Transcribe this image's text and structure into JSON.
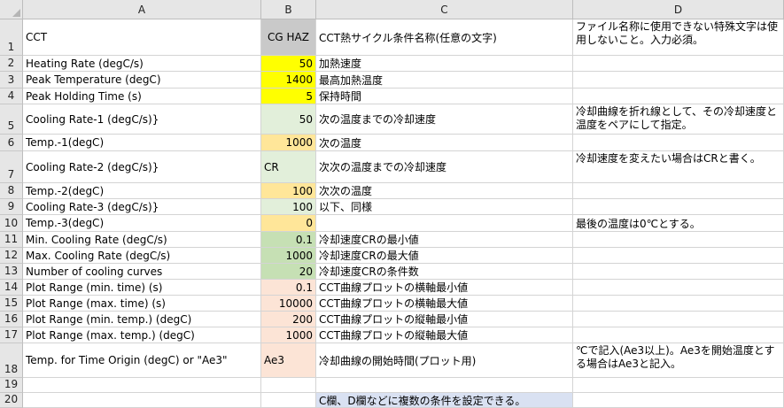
{
  "colors": {
    "yellow": "#ffff00",
    "light_green": "#e2efda",
    "orange": "#ffe699",
    "green": "#c6e0b4",
    "peach": "#fce4d6",
    "gray": "#c9c9c9",
    "blue": "#d9e1f2",
    "header": "#e6e6e6"
  },
  "columns": [
    "A",
    "B",
    "C",
    "D"
  ],
  "rows": [
    {
      "num": "1",
      "a": "CCT",
      "b": "CG HAZ",
      "c": "CCT熱サイクル条件名称(任意の文字)",
      "d": "ファイル名称に使用できない特殊文字は使用しないこと。入力必須。",
      "b_fill": "gray",
      "b_align": "center"
    },
    {
      "num": "2",
      "a": "Heating Rate (degC/s)",
      "b": "50",
      "c": "加熱速度",
      "d": "",
      "b_fill": "yellow",
      "b_align": "right"
    },
    {
      "num": "3",
      "a": "Peak Temperature (degC)",
      "b": "1400",
      "c": "最高加熱温度",
      "d": "",
      "b_fill": "yellow",
      "b_align": "right"
    },
    {
      "num": "4",
      "a": "Peak Holding Time (s)",
      "b": "5",
      "c": "保持時間",
      "d": "",
      "b_fill": "yellow",
      "b_align": "right"
    },
    {
      "num": "5",
      "a": "Cooling Rate-1 (degC/s)}",
      "b": "50",
      "c": "次の温度までの冷却速度",
      "d": "冷却曲線を折れ線として、その冷却速度と温度をペアにして指定。",
      "b_fill": "light_green",
      "b_align": "right"
    },
    {
      "num": "6",
      "a": "Temp.-1(degC)",
      "b": "1000",
      "c": "次の温度",
      "d": "",
      "b_fill": "orange",
      "b_align": "right"
    },
    {
      "num": "7",
      "a": "Cooling Rate-2 (degC/s)}",
      "b": "CR",
      "c": "次次の温度までの冷却速度",
      "d": "冷却速度を変えたい場合はCRと書く。",
      "b_fill": "light_green",
      "b_align": "left"
    },
    {
      "num": "8",
      "a": "Temp.-2(degC)",
      "b": "100",
      "c": "次次の温度",
      "d": "",
      "b_fill": "orange",
      "b_align": "right"
    },
    {
      "num": "9",
      "a": "Cooling Rate-3 (degC/s)}",
      "b": "100",
      "c": "以下、同様",
      "d": "",
      "b_fill": "light_green",
      "b_align": "right"
    },
    {
      "num": "10",
      "a": "Temp.-3(degC)",
      "b": "0",
      "c": "",
      "d": "最後の温度は0℃とする。",
      "b_fill": "orange",
      "b_align": "right"
    },
    {
      "num": "11",
      "a": "Min. Cooling Rate (degC/s)",
      "b": "0.1",
      "c": "冷却速度CRの最小値",
      "d": "",
      "b_fill": "green",
      "b_align": "right"
    },
    {
      "num": "12",
      "a": "Max. Cooling Rate (degC/s)",
      "b": "1000",
      "c": "冷却速度CRの最大値",
      "d": "",
      "b_fill": "green",
      "b_align": "right"
    },
    {
      "num": "13",
      "a": "Number of cooling curves",
      "b": "20",
      "c": "冷却速度CRの条件数",
      "d": "",
      "b_fill": "green",
      "b_align": "right"
    },
    {
      "num": "14",
      "a": "Plot Range (min. time) (s)",
      "b": "0.1",
      "c": "CCT曲線プロットの横軸最小値",
      "d": "",
      "b_fill": "peach",
      "b_align": "right"
    },
    {
      "num": "15",
      "a": "Plot Range (max. time) (s)",
      "b": "10000",
      "c": "CCT曲線プロットの横軸最大値",
      "d": "",
      "b_fill": "peach",
      "b_align": "right"
    },
    {
      "num": "16",
      "a": "Plot Range (min. temp.) (degC)",
      "b": "200",
      "c": "CCT曲線プロットの縦軸最小値",
      "d": "",
      "b_fill": "peach",
      "b_align": "right"
    },
    {
      "num": "17",
      "a": "Plot Range (max. temp.) (degC)",
      "b": "1000",
      "c": "CCT曲線プロットの縦軸最大値",
      "d": "",
      "b_fill": "peach",
      "b_align": "right"
    },
    {
      "num": "18",
      "a": "Temp. for Time Origin (degC) or \"Ae3\"",
      "b": "Ae3",
      "c": "冷却曲線の開始時間(プロット用)",
      "d": "℃で記入(Ae3以上)。Ae3を開始温度とする場合はAe3と記入。",
      "b_fill": "peach",
      "b_align": "left"
    },
    {
      "num": "19",
      "a": "",
      "b": "",
      "c": "",
      "d": "",
      "b_fill": "",
      "b_align": "left"
    },
    {
      "num": "20",
      "a": "",
      "b": "",
      "c": "C欄、D欄などに複数の条件を設定できる。",
      "d": "",
      "b_fill": "",
      "b_align": "left",
      "c_fill": "blue"
    }
  ]
}
